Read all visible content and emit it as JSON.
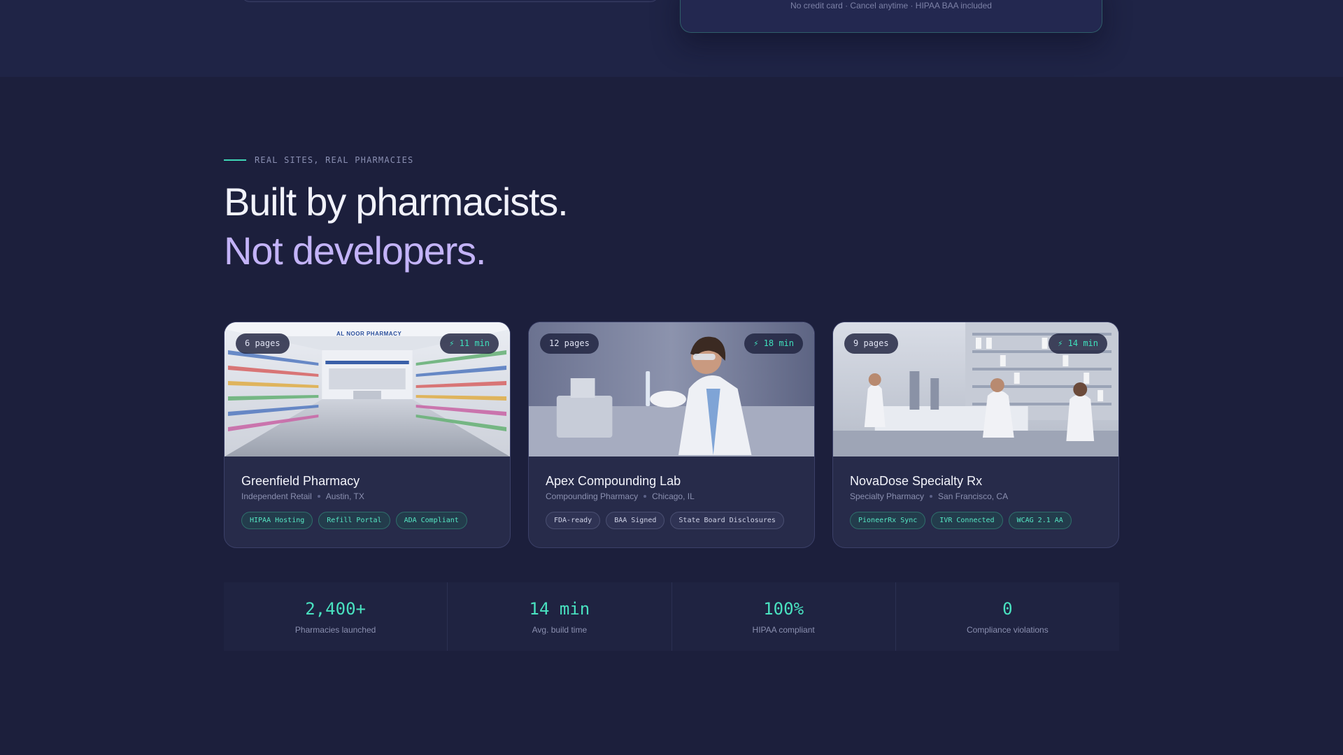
{
  "top": {
    "fineprint": "No credit card · Cancel anytime · HIPAA BAA included"
  },
  "section": {
    "eyebrow": "REAL SITES, REAL PHARMACIES",
    "headline_line1": "Built by pharmacists.",
    "headline_line2": "Not developers."
  },
  "cards": [
    {
      "pages": "6 pages",
      "time": "⚡ 11 min",
      "name": "Greenfield Pharmacy",
      "type": "Independent Retail",
      "location": "Austin, TX",
      "image_sign": "AL NOOR PHARMACY",
      "tags": [
        {
          "label": "HIPAA Hosting",
          "style": "teal"
        },
        {
          "label": "Refill Portal",
          "style": "teal"
        },
        {
          "label": "ADA Compliant",
          "style": "teal"
        }
      ]
    },
    {
      "pages": "12 pages",
      "time": "⚡ 18 min",
      "name": "Apex Compounding Lab",
      "type": "Compounding Pharmacy",
      "location": "Chicago, IL",
      "tags": [
        {
          "label": "FDA-ready",
          "style": "grey"
        },
        {
          "label": "BAA Signed",
          "style": "grey"
        },
        {
          "label": "State Board Disclosures",
          "style": "grey"
        }
      ]
    },
    {
      "pages": "9 pages",
      "time": "⚡ 14 min",
      "name": "NovaDose Specialty Rx",
      "type": "Specialty Pharmacy",
      "location": "San Francisco, CA",
      "tags": [
        {
          "label": "PioneerRx Sync",
          "style": "teal"
        },
        {
          "label": "IVR Connected",
          "style": "teal"
        },
        {
          "label": "WCAG 2.1 AA",
          "style": "teal"
        }
      ]
    }
  ],
  "stats": [
    {
      "value": "2,400+",
      "label": "Pharmacies launched"
    },
    {
      "value": "14 min",
      "label": "Avg. build time"
    },
    {
      "value": "100%",
      "label": "HIPAA compliant"
    },
    {
      "value": "0",
      "label": "Compliance violations"
    }
  ],
  "colors": {
    "background": "#1c1f3c",
    "accent_teal": "#3ed6b5",
    "accent_lavender": "#c3b3f8",
    "card": "#272b4a"
  }
}
